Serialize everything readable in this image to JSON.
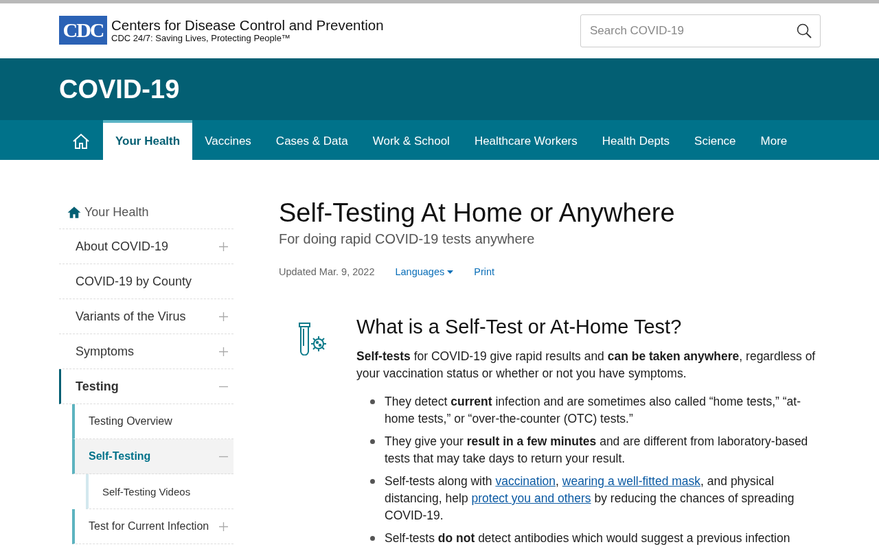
{
  "logo": {
    "mark": "CDC",
    "title": "Centers for Disease Control and Prevention",
    "tagline": "CDC 24/7: Saving Lives, Protecting People™"
  },
  "search": {
    "placeholder": "Search COVID-19"
  },
  "banner": {
    "title": "COVID-19"
  },
  "nav": [
    {
      "kind": "home",
      "selected": false
    },
    {
      "kind": "text",
      "label": "Your Health",
      "selected": true
    },
    {
      "kind": "text",
      "label": "Vaccines",
      "selected": false
    },
    {
      "kind": "text",
      "label": "Cases & Data",
      "selected": false
    },
    {
      "kind": "text",
      "label": "Work & School",
      "selected": false
    },
    {
      "kind": "text",
      "label": "Healthcare Workers",
      "selected": false
    },
    {
      "kind": "text",
      "label": "Health Depts",
      "selected": false
    },
    {
      "kind": "text",
      "label": "Science",
      "selected": false
    },
    {
      "kind": "text",
      "label": "More",
      "selected": false
    }
  ],
  "sidebar": {
    "home": "Your Health",
    "items": [
      {
        "label": "About COVID-19",
        "expandable": true,
        "expanded": false,
        "selected": false
      },
      {
        "label": "COVID-19 by County",
        "expandable": false,
        "expanded": false,
        "selected": false
      },
      {
        "label": "Variants of the Virus",
        "expandable": true,
        "expanded": false,
        "selected": false
      },
      {
        "label": "Symptoms",
        "expandable": true,
        "expanded": false,
        "selected": false
      },
      {
        "label": "Testing",
        "expandable": true,
        "expanded": true,
        "selected": false,
        "children": [
          {
            "label": "Testing Overview",
            "expandable": false,
            "expanded": false,
            "selected": false
          },
          {
            "label": "Self-Testing",
            "expandable": true,
            "expanded": true,
            "selected": true,
            "children": [
              {
                "label": "Self-Testing Videos",
                "expandable": false,
                "expanded": false,
                "selected": false
              }
            ]
          },
          {
            "label": "Test for Current Infection",
            "expandable": true,
            "expanded": false,
            "selected": false
          }
        ]
      }
    ]
  },
  "page": {
    "title": "Self-Testing At Home or Anywhere",
    "subtitle": "For doing rapid COVID-19 tests anywhere",
    "updated": "Updated Mar. 9, 2022",
    "languages": "Languages",
    "print": "Print"
  },
  "section": {
    "heading": "What is a Self-Test or At-Home Test?",
    "intro": "**Self-tests** for COVID-19 give rapid results and **can be taken anywhere**, regardless of your vaccination status or whether or not you have symptoms.",
    "bullets": [
      [
        {
          "kind": "text",
          "text": "They detect **current** infection and are sometimes also called “home tests,” “at-home tests,” or “over-the-counter (OTC) tests.”"
        }
      ],
      [
        {
          "kind": "text",
          "text": "They give your **result in a few minutes** and are different from laboratory-based tests that may take days to return your result."
        }
      ],
      [
        {
          "kind": "text",
          "text": "Self-tests along with "
        },
        {
          "kind": "link",
          "text": "vaccination"
        },
        {
          "kind": "text",
          "text": ", "
        },
        {
          "kind": "link",
          "text": "wearing a well-fitted mask"
        },
        {
          "kind": "text",
          "text": ", and physical distancing, help "
        },
        {
          "kind": "link",
          "text": "protect you and others"
        },
        {
          "kind": "text",
          "text": " by reducing the chances of spreading COVID-19."
        }
      ],
      [
        {
          "kind": "text",
          "text": "Self-tests **do not** detect antibodies which would suggest a previous infection"
        }
      ]
    ]
  }
}
